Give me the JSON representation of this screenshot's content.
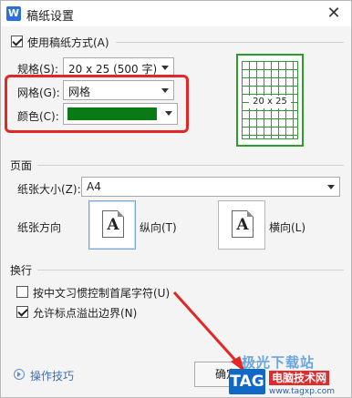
{
  "window": {
    "title": "稿纸设置",
    "logo_letter": "W",
    "close_glyph": "✕"
  },
  "use_paper": {
    "checked": true,
    "label": "使用稿纸方式(A)"
  },
  "spec": {
    "label": "规格(S):",
    "value": "20 x 25 (500 字)"
  },
  "grid": {
    "label": "网格(G):",
    "value": "网格"
  },
  "color": {
    "label": "颜色(C):",
    "value_hex": "#0a7a14"
  },
  "preview": {
    "label": "20 x 25",
    "color_hex": "#2a9d2a"
  },
  "page_section": {
    "title": "页面",
    "paper_size_label": "纸张大小(Z):",
    "paper_size_value": "A4",
    "orientation_label": "纸张方向",
    "portrait_label": "纵向(T)",
    "landscape_label": "横向(L)",
    "page_letter": "A",
    "selected": "portrait"
  },
  "wrap_section": {
    "title": "换行",
    "option1_label": "按中文习惯控制首尾字符(U)",
    "option1_checked": false,
    "option2_label": "允许标点溢出边界(N)",
    "option2_checked": true
  },
  "footer": {
    "help_link": "操作技巧",
    "ok_label": "确定"
  },
  "watermark": {
    "top_text": "极光下载站",
    "tag": "TAG",
    "cn": "电脑技术网",
    "url": "www.tagxp.com"
  },
  "colors": {
    "highlight_red": "#e32626",
    "link_blue": "#3a6fbf"
  }
}
